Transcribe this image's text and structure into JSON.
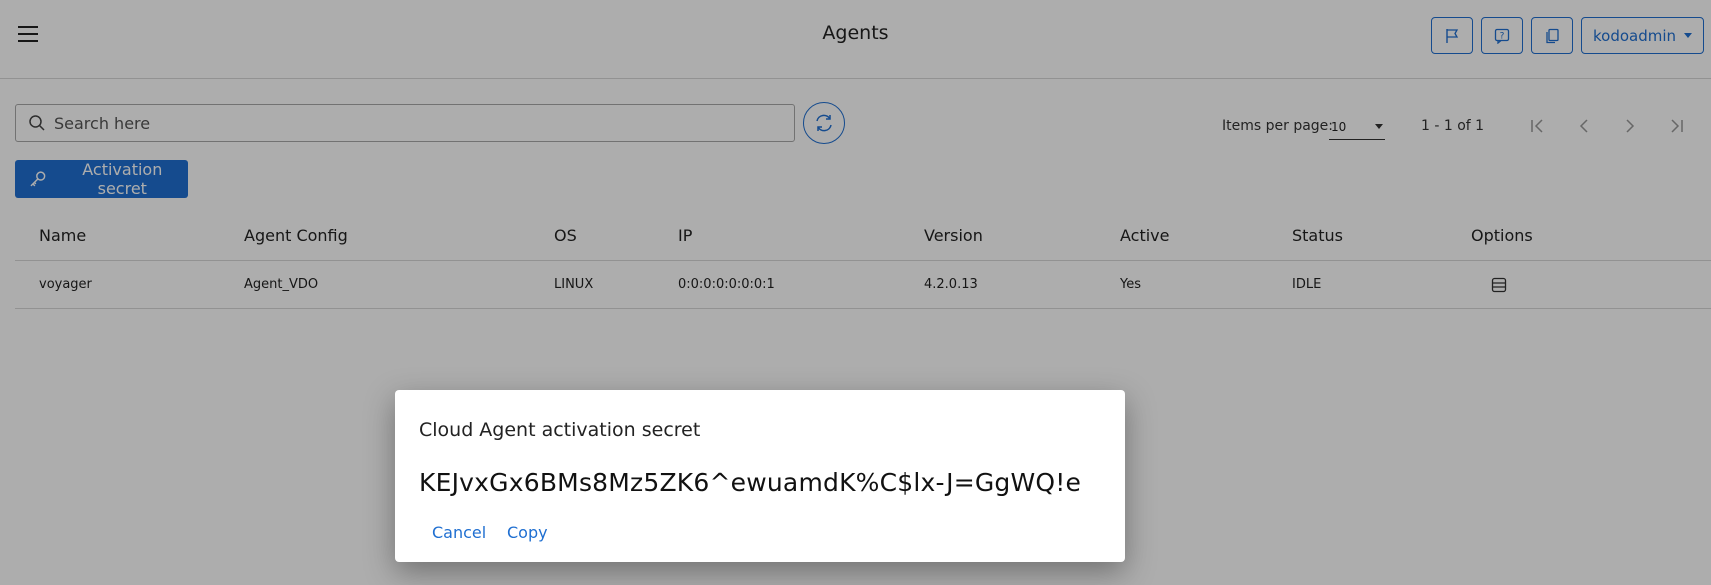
{
  "header": {
    "title": "Agents",
    "user_label": "kodoadmin",
    "icons": [
      "menu-icon",
      "flag-icon",
      "help-icon",
      "copy-icon"
    ]
  },
  "search": {
    "placeholder": "Search here"
  },
  "pager": {
    "items_per_page_label": "Items per page:",
    "items_per_page_value": "10",
    "range": "1 - 1 of 1"
  },
  "activation_button": {
    "label": "Activation secret"
  },
  "table": {
    "columns": [
      "Name",
      "Agent Config",
      "OS",
      "IP",
      "Version",
      "Active",
      "Status",
      "Options"
    ],
    "rows": [
      {
        "name": "voyager",
        "agent_config": "Agent_VDO",
        "os": "LINUX",
        "ip": "0:0:0:0:0:0:0:1",
        "version": "4.2.0.13",
        "active": "Yes",
        "status": "IDLE"
      }
    ]
  },
  "dialog": {
    "title": "Cloud Agent activation secret",
    "secret": "KEJvxGx6BMs8Mz5ZK6^ewuamdK%C$lx-J=GgWQ!e",
    "cancel_label": "Cancel",
    "copy_label": "Copy"
  },
  "colors": {
    "accent": "#1f6fd1",
    "status_idle": "#2e9e3e"
  }
}
